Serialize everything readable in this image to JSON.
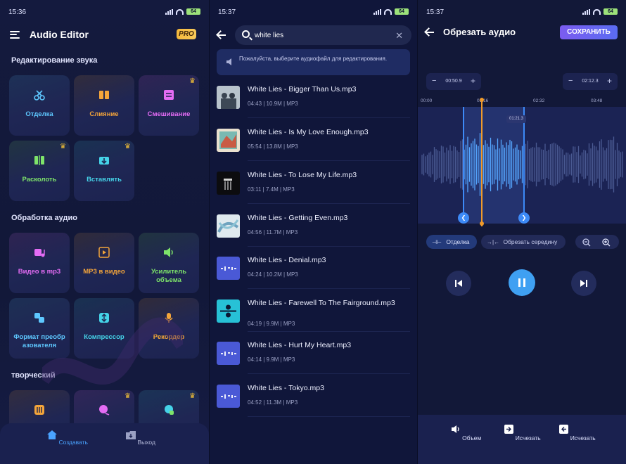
{
  "colors": {
    "accent": "#3d8af7",
    "playhead": "#f09a2a",
    "pro_badge": "#f6b93b",
    "save_button": "#7b5cf0"
  },
  "home": {
    "status": {
      "time": "15:36",
      "battery": "64"
    },
    "header": {
      "title": "Audio Editor",
      "pro_label": "PRO"
    },
    "sections": [
      {
        "title": "Редактирование звука",
        "tiles": [
          {
            "label": "Отделка",
            "icon": "scissors-icon",
            "color": "#5ec8ff"
          },
          {
            "label": "Слияние",
            "icon": "merge-icon",
            "color": "#f4a53a"
          },
          {
            "label": "Смешивание",
            "icon": "mix-icon",
            "color": "#e46cf4",
            "premium": true
          },
          {
            "label": "Расколоть",
            "icon": "split-icon",
            "color": "#7ee46a",
            "premium": true
          },
          {
            "label": "Вставлять",
            "icon": "insert-icon",
            "color": "#45d3e8",
            "premium": true
          }
        ]
      },
      {
        "title": "Обработка аудио",
        "tiles": [
          {
            "label": "Видео в mp3",
            "icon": "video-to-mp3-icon",
            "color": "#e46cf4"
          },
          {
            "label": "MP3 в видео",
            "icon": "mp3-to-video-icon",
            "color": "#f4a53a"
          },
          {
            "label": "Усилитель объема",
            "icon": "volume-booster-icon",
            "color": "#7ee46a"
          },
          {
            "label": "Формат преобр азователя",
            "icon": "format-converter-icon",
            "color": "#5ec8ff"
          },
          {
            "label": "Компрессор",
            "icon": "compressor-icon",
            "color": "#45d3e8"
          },
          {
            "label": "Рекордер",
            "icon": "microphone-icon",
            "color": "#f4a53a"
          }
        ]
      },
      {
        "title": "творческий",
        "tiles": [
          {
            "label": "",
            "icon": "equalizer-icon",
            "color": "#f4a53a"
          },
          {
            "label": "",
            "icon": "ringtone-icon",
            "color": "#e46cf4",
            "premium": true
          },
          {
            "label": "",
            "icon": "voice-changer-icon",
            "color": "#45d3e8",
            "premium": true
          }
        ]
      }
    ],
    "nav": [
      {
        "label": "Создавать",
        "icon": "home-icon",
        "active": true
      },
      {
        "label": "Выход",
        "icon": "output-icon",
        "active": false
      }
    ]
  },
  "search": {
    "status": {
      "time": "15:37",
      "battery": "64"
    },
    "query": "white lies",
    "banner": "Пожалуйста, выберите аудиофайл для редактирования.",
    "results": [
      {
        "name": "White Lies - Bigger Than Us.mp3",
        "meta": "04:43 | 10.9M | MP3",
        "art": "band-photo"
      },
      {
        "name": "White Lies - Is My Love Enough.mp3",
        "meta": "05:54 | 13.8M | MP3",
        "art": "painted-cover"
      },
      {
        "name": "White Lies - To Lose My Life.mp3",
        "meta": "03:11 | 7.4M | MP3",
        "art": "dark-cover"
      },
      {
        "name": "White Lies - Getting Even.mp3",
        "meta": "04:56 | 11.7M | MP3",
        "art": "light-cover"
      },
      {
        "name": "White Lies - Denial.mp3",
        "meta": "04:24 | 10.2M | MP3",
        "art": "placeholder"
      },
      {
        "name": "White Lies - Farewell To The Fairground.mp3",
        "meta": "04:19 | 9.9M | MP3",
        "art": "teal-cover"
      },
      {
        "name": "White Lies - Hurt My Heart.mp3",
        "meta": "04:14 | 9.9M | MP3",
        "art": "placeholder"
      },
      {
        "name": "White Lies - Tokyo.mp3",
        "meta": "04:52 | 11.3M | MP3",
        "art": "placeholder"
      }
    ]
  },
  "trim": {
    "status": {
      "time": "15:37",
      "battery": "64"
    },
    "title": "Обрезать аудио",
    "save_label": "СОХРАНИТЬ",
    "start_time": "00:50.9",
    "end_time": "02:12.3",
    "timeline_ticks": [
      "00:00",
      "01:16",
      "02:32",
      "03:48"
    ],
    "selection_duration": "01:21.3",
    "selection": {
      "start_fraction": 0.22,
      "end_fraction": 0.51,
      "playhead_fraction": 0.305
    },
    "modes": [
      {
        "label": "Отделка",
        "active": true
      },
      {
        "label": "Обрезать середину",
        "active": false
      }
    ],
    "tools": [
      {
        "label": "Объем",
        "icon": "volume-icon"
      },
      {
        "label": "Исчезать",
        "icon": "fade-in-icon"
      },
      {
        "label": "Исчезать",
        "icon": "fade-out-icon"
      }
    ]
  }
}
